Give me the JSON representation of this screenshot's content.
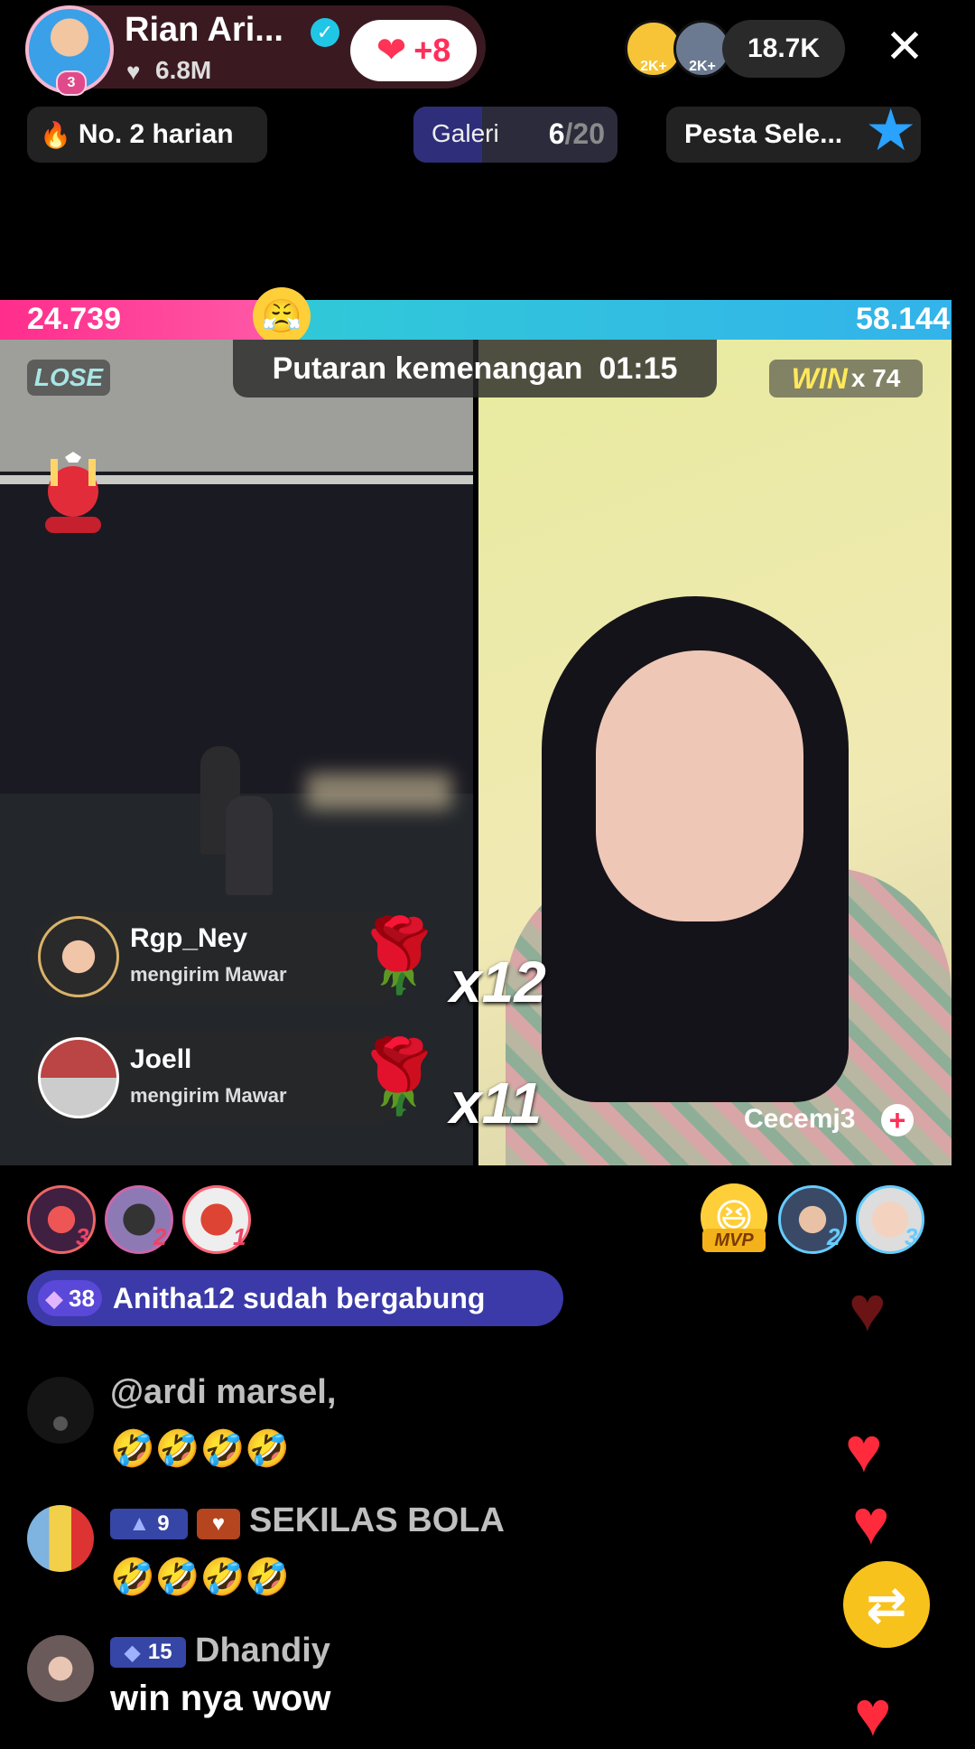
{
  "header": {
    "host_name": "Rian Ari...",
    "host_level": "3",
    "likes": "6.8M",
    "plus_count": "+8",
    "viewer_badges": [
      "2K+",
      "2K+"
    ],
    "viewer_count": "18.7K",
    "close_icon": "✕"
  },
  "subheader": {
    "rank_text": "No. 2 harian",
    "gallery_label": "Galeri",
    "gallery_current": "6",
    "gallery_total": "/20",
    "event_text": "Pesta Sele..."
  },
  "battle": {
    "score_left": "24.739",
    "score_right": "58.144",
    "left_fraction": 0.298,
    "round_label": "Putaran kemenangan",
    "timer": "01:15",
    "lose_label": "LOSE",
    "win_label": "WIN",
    "win_multiplier": "x 74",
    "opponent_name": "Cecemj3",
    "follow_symbol": "+"
  },
  "gifts": [
    {
      "name": "Rgp_Ney",
      "action": "mengirim Mawar",
      "count": "x12"
    },
    {
      "name": "Joell",
      "action": "mengirim Mawar",
      "count": "x11"
    }
  ],
  "supporters": {
    "left_ranks": [
      "3",
      "2",
      "1"
    ],
    "right_mvp": "MVP",
    "right_ranks": [
      "2",
      "3"
    ]
  },
  "join_banner": {
    "badge_level": "38",
    "text": "Anitha12 sudah bergabung"
  },
  "chat": [
    {
      "name": "@ardi marsel,",
      "message": "🤣🤣🤣🤣"
    },
    {
      "level": "9",
      "name": "SEKILAS BOLA",
      "message": "🤣🤣🤣🤣"
    },
    {
      "level": "15",
      "name": "Dhandiy",
      "message": "win nya wow"
    }
  ],
  "colors": {
    "left_team": "#ff2d8c",
    "right_team": "#33b3ea",
    "heart": "#ff2a3c",
    "share": "#f7c21b"
  }
}
